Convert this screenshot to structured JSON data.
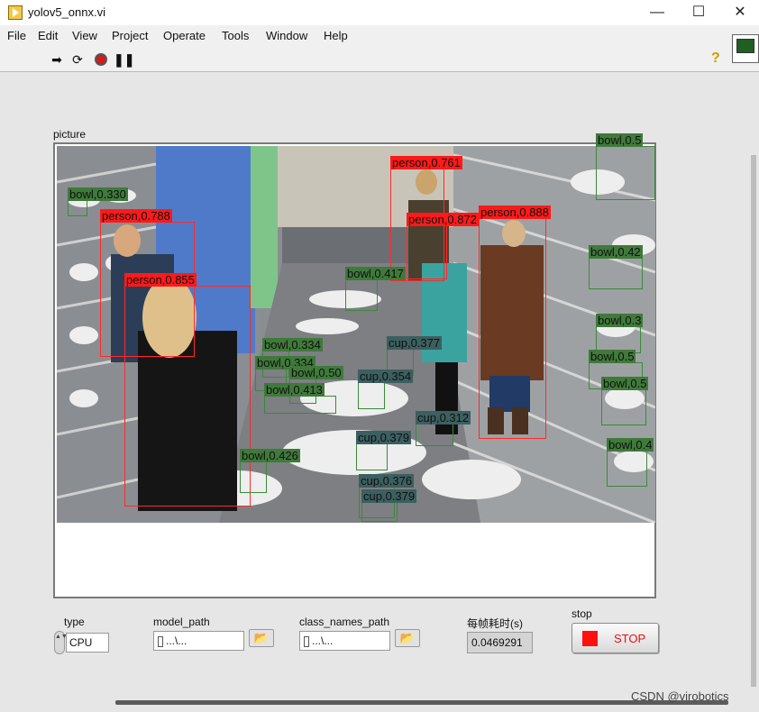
{
  "window": {
    "title": "yolov5_onnx.vi",
    "min_glyph": "—",
    "max_glyph": "☐",
    "close_glyph": "✕"
  },
  "menu": [
    "File",
    "Edit",
    "View",
    "Project",
    "Operate",
    "Tools",
    "Window",
    "Help"
  ],
  "toolbar": {
    "run_continuously_glyph": "⟳",
    "run_glyph": "➡",
    "pause_glyph": "❚❚",
    "help_glyph": "?"
  },
  "picture": {
    "label": "picture",
    "detections": [
      {
        "label": "bowl,0.330"
      },
      {
        "label": "person,0.788"
      },
      {
        "label": "person,0.855"
      },
      {
        "label": "person,0.761"
      },
      {
        "label": "person,0.872"
      },
      {
        "label": "person,0.888"
      },
      {
        "label": "bowl,0.417"
      },
      {
        "label": "bowl,0.334"
      },
      {
        "label": "bowl,0.334"
      },
      {
        "label": "bowl,0.50"
      },
      {
        "label": "bowl,0.413"
      },
      {
        "label": "cup,0.377"
      },
      {
        "label": "cup,0.354"
      },
      {
        "label": "cup,0.312"
      },
      {
        "label": "cup,0.379"
      },
      {
        "label": "bowl,0.426"
      },
      {
        "label": "cup,0.376"
      },
      {
        "label": "cup,0.379"
      },
      {
        "label": "bowl,0.5"
      },
      {
        "label": "bowl,0.42"
      },
      {
        "label": "bowl,0.3"
      },
      {
        "label": "bowl,0.5"
      },
      {
        "label": "bowl,0.5"
      },
      {
        "label": "bowl,0.4"
      }
    ]
  },
  "controls": {
    "type": {
      "label": "type",
      "value": "CPU",
      "spin_glyph": "▲▼"
    },
    "model_path": {
      "label": "model_path",
      "value": "...\\...",
      "browse_glyph": "📂"
    },
    "class_names_path": {
      "label": "class_names_path",
      "value": "...\\...",
      "browse_glyph": "📂"
    },
    "frame_time": {
      "label": "每帧耗时(s)",
      "value": "0.0469291"
    },
    "stop": {
      "label": "stop",
      "button_text": "STOP"
    }
  },
  "watermark": "CSDN @virobotics",
  "colors": {
    "person_box": "#ff1a1a",
    "bowl_box": "#3f7a3a",
    "cup_box": "#3c5f60",
    "stop_red": "#ff1010"
  }
}
